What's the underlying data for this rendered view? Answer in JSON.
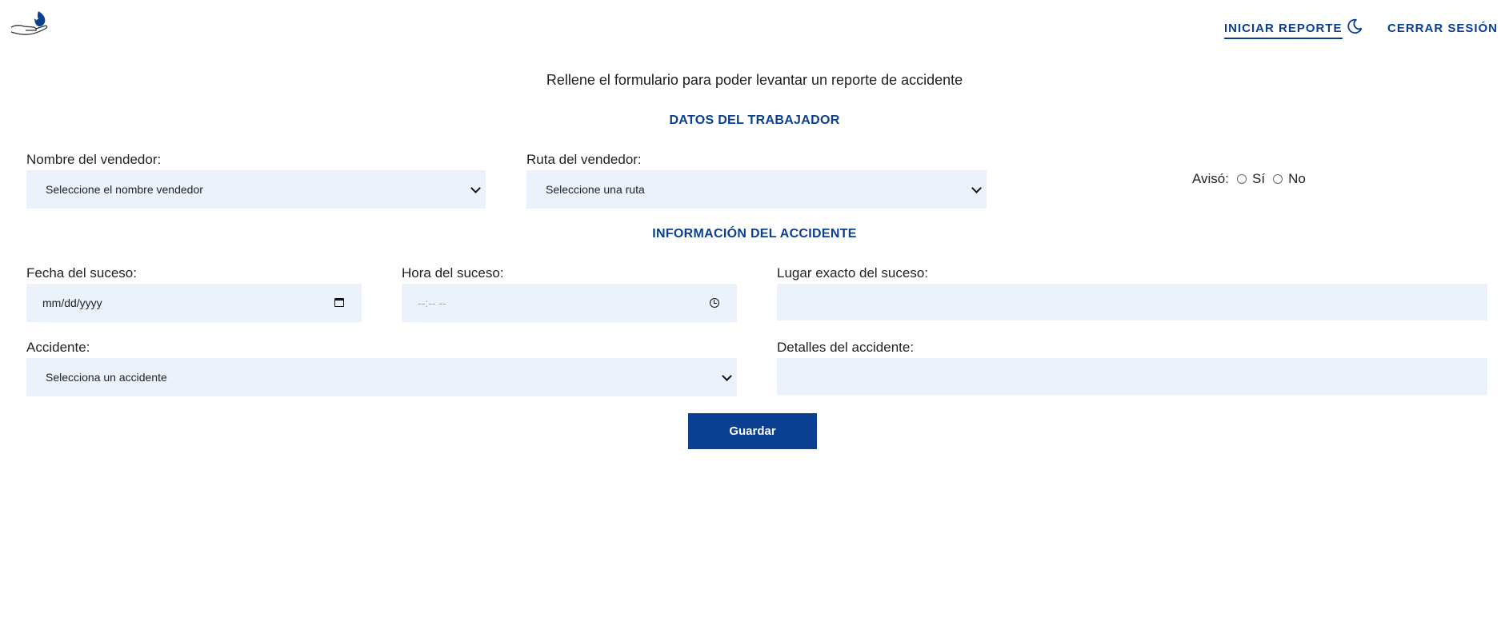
{
  "header": {
    "logo_icon": "hand-with-flame-logo",
    "nav_report_label": "INICIAR REPORTE",
    "theme_icon": "moon-icon",
    "nav_logout_label": "CERRAR SESIÓN"
  },
  "intro_text": "Rellene el formulario para poder levantar un reporte de accidente",
  "worker_section": {
    "title": "DATOS DEL TRABAJADOR",
    "seller_name_label": "Nombre del vendedor:",
    "seller_name_value": "Seleccione el nombre vendedor",
    "route_label": "Ruta del vendedor:",
    "route_value": "Seleccione una ruta",
    "notified_label": "Avisó:",
    "notified_options": [
      "Sí",
      "No"
    ]
  },
  "accident_section": {
    "title": "INFORMACIÓN DEL ACCIDENTE",
    "date_label": "Fecha del suceso:",
    "date_placeholder": "mm/dd/yyyy",
    "time_label": "Hora del suceso:",
    "time_placeholder": "--:-- --",
    "place_label": "Lugar exacto del suceso:",
    "place_value": "",
    "accident_label": "Accidente:",
    "accident_value": "Selecciona un accidente",
    "details_label": "Detalles del accidente:",
    "details_value": ""
  },
  "save_button_label": "Guardar",
  "colors": {
    "accent": "#0a3f91",
    "field_bg": "#ebf2fc"
  }
}
